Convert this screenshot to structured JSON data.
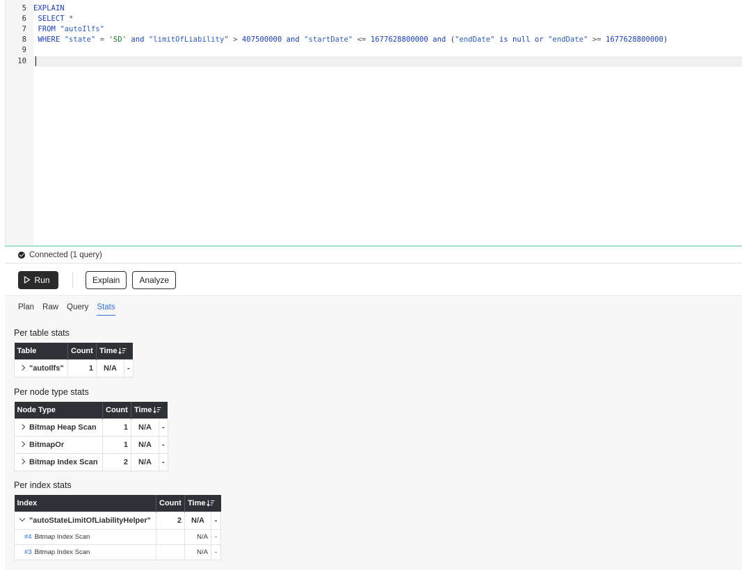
{
  "editor": {
    "line_numbers": [
      "5",
      "6",
      "7",
      "8",
      "9",
      "10"
    ],
    "lines": [
      [
        {
          "t": "kw",
          "v": "EXPLAIN"
        }
      ],
      [
        {
          "t": "kw",
          "v": " SELECT"
        },
        {
          "t": "op",
          "v": " *"
        }
      ],
      [
        {
          "t": "kw",
          "v": " FROM"
        },
        {
          "t": "plain",
          "v": " "
        },
        {
          "t": "ident",
          "v": "\"autoIlfs\""
        }
      ],
      [
        {
          "t": "kw",
          "v": " WHERE"
        },
        {
          "t": "plain",
          "v": " "
        },
        {
          "t": "ident",
          "v": "\"state\""
        },
        {
          "t": "op",
          "v": " = "
        },
        {
          "t": "str",
          "v": "'SD'"
        },
        {
          "t": "kw",
          "v": " and"
        },
        {
          "t": "plain",
          "v": " "
        },
        {
          "t": "ident",
          "v": "\"limitOfLiability\""
        },
        {
          "t": "op",
          "v": " > "
        },
        {
          "t": "num",
          "v": "407500000"
        },
        {
          "t": "kw",
          "v": " and"
        },
        {
          "t": "plain",
          "v": " "
        },
        {
          "t": "ident",
          "v": "\"startDate\""
        },
        {
          "t": "op",
          "v": " <= "
        },
        {
          "t": "num",
          "v": "1677628800000"
        },
        {
          "t": "kw",
          "v": " and"
        },
        {
          "t": "plain",
          "v": " ("
        },
        {
          "t": "ident",
          "v": "\"endDate\""
        },
        {
          "t": "kw",
          "v": " is null or"
        },
        {
          "t": "plain",
          "v": " "
        },
        {
          "t": "ident",
          "v": "\"endDate\""
        },
        {
          "t": "op",
          "v": " >= "
        },
        {
          "t": "num",
          "v": "1677628800000"
        },
        {
          "t": "plain",
          "v": ")"
        }
      ],
      [],
      []
    ]
  },
  "status": {
    "text": "Connected (1 query)",
    "icon": "check-circle-icon"
  },
  "toolbar": {
    "run_label": "Run",
    "explain_label": "Explain",
    "analyze_label": "Analyze"
  },
  "tabs": [
    {
      "label": "Plan",
      "active": false
    },
    {
      "label": "Raw",
      "active": false
    },
    {
      "label": "Query",
      "active": false
    },
    {
      "label": "Stats",
      "active": true
    }
  ],
  "per_table": {
    "title": "Per table stats",
    "headers": [
      "Table",
      "Count",
      "Time"
    ],
    "rows": [
      {
        "name": "\"autoIlfs\"",
        "count": "1",
        "time": "N/A",
        "extra": "-"
      }
    ]
  },
  "per_node": {
    "title": "Per node type stats",
    "headers": [
      "Node Type",
      "Count",
      "Time"
    ],
    "rows": [
      {
        "name": "Bitmap Heap Scan",
        "count": "1",
        "time": "N/A",
        "extra": "-"
      },
      {
        "name": "BitmapOr",
        "count": "1",
        "time": "N/A",
        "extra": "-"
      },
      {
        "name": "Bitmap Index Scan",
        "count": "2",
        "time": "N/A",
        "extra": "-"
      }
    ]
  },
  "per_index": {
    "title": "Per index stats",
    "headers": [
      "Index",
      "Count",
      "Time"
    ],
    "rows": [
      {
        "name": "\"autoStateLimitOfLiabilityHelper\"",
        "count": "2",
        "time": "N/A",
        "extra": "-"
      }
    ],
    "subrows": [
      {
        "id": "#4",
        "name": "Bitmap Index Scan",
        "time": "N/A",
        "extra": "-"
      },
      {
        "id": "#3",
        "name": "Bitmap Index Scan",
        "time": "N/A",
        "extra": "-"
      }
    ]
  },
  "colors": {
    "accent": "#2f6fd6",
    "header_bg": "#2e3135",
    "divider": "#9fe3c6"
  }
}
